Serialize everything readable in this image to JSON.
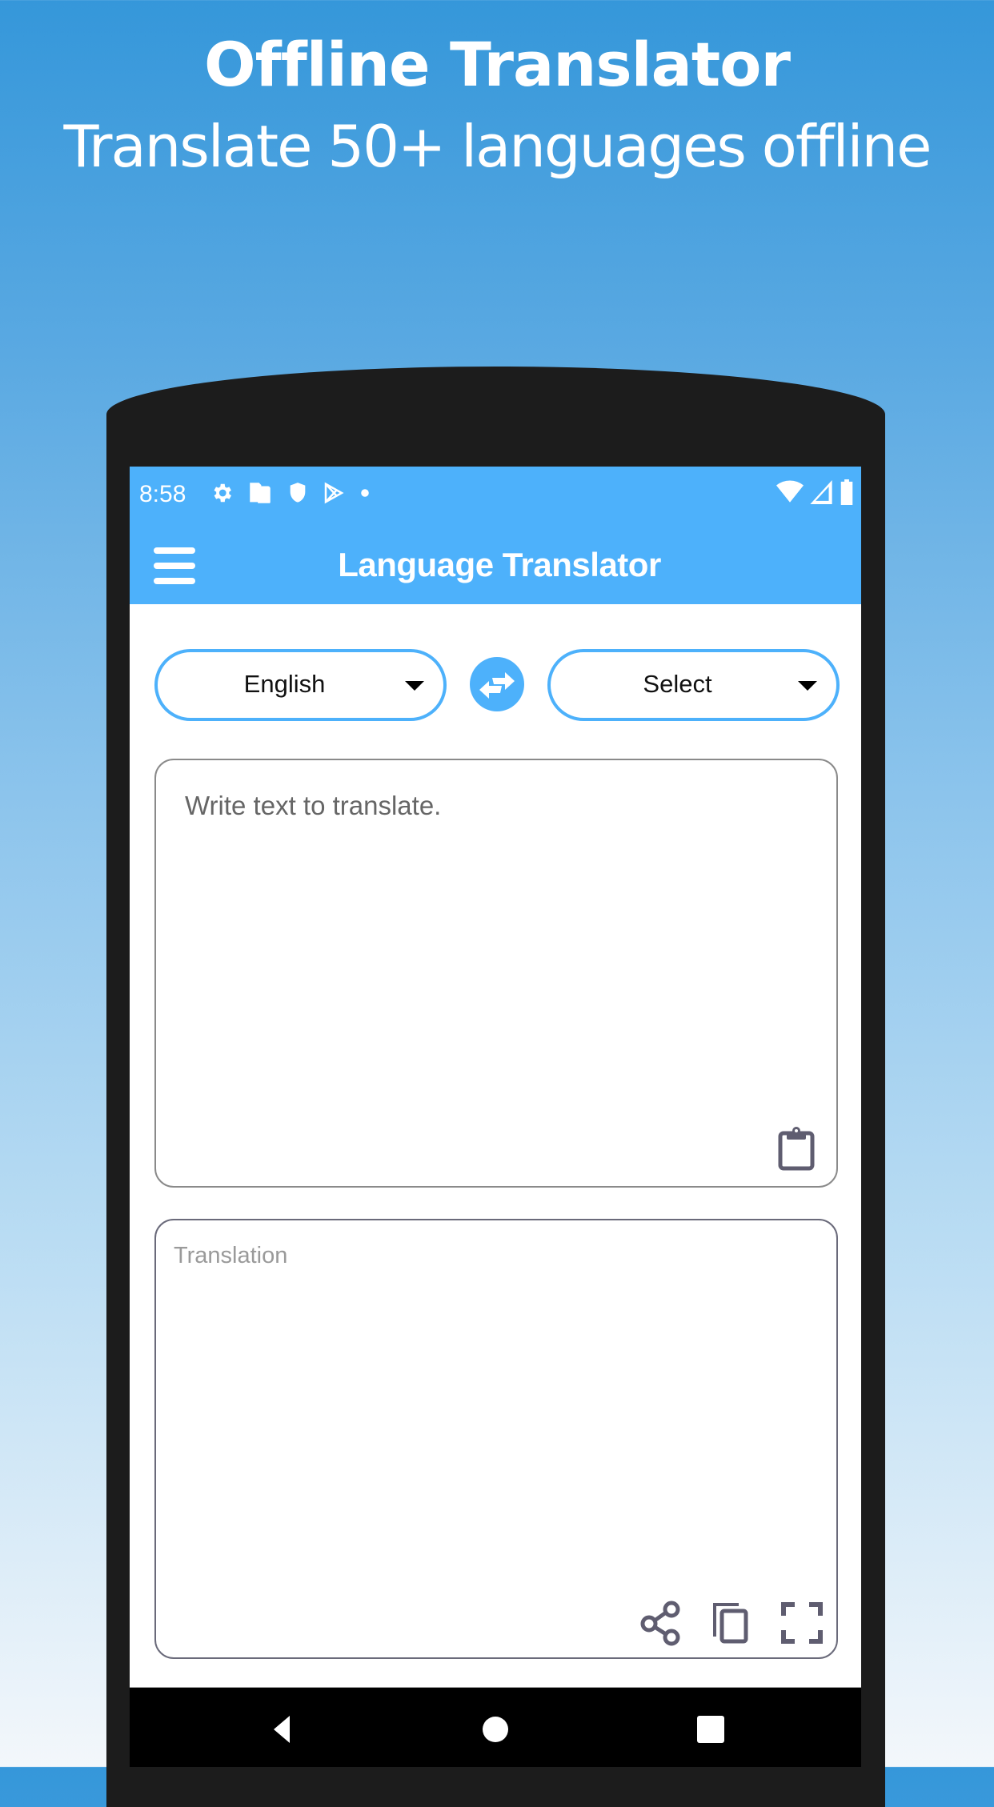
{
  "promo": {
    "title": "Offline Translator",
    "subtitle": "Translate 50+ languages offline"
  },
  "status_bar": {
    "time": "8:58",
    "left_icons": [
      "gear-icon",
      "sd-card-icon",
      "shield-icon",
      "play-store-icon",
      "dot-icon"
    ],
    "right_icons": [
      "wifi-icon",
      "cell-signal-icon",
      "battery-icon"
    ]
  },
  "app_bar": {
    "menu_icon": "hamburger-menu-icon",
    "title": "Language Translator"
  },
  "language_selector": {
    "source": "English",
    "target": "Select",
    "swap_icon": "swap-arrows-icon"
  },
  "input": {
    "placeholder": "Write text to translate.",
    "value": "",
    "paste_icon": "clipboard-icon"
  },
  "output": {
    "placeholder": "Translation",
    "value": "",
    "actions": [
      {
        "name": "share",
        "icon": "share-icon"
      },
      {
        "name": "copy",
        "icon": "copy-icon"
      },
      {
        "name": "fullscreen",
        "icon": "fullscreen-icon"
      }
    ]
  },
  "nav_bar": {
    "buttons": [
      "back",
      "home",
      "recents"
    ]
  },
  "colors": {
    "accent": "#4db1fb",
    "icon_gray": "#5f5d70"
  }
}
